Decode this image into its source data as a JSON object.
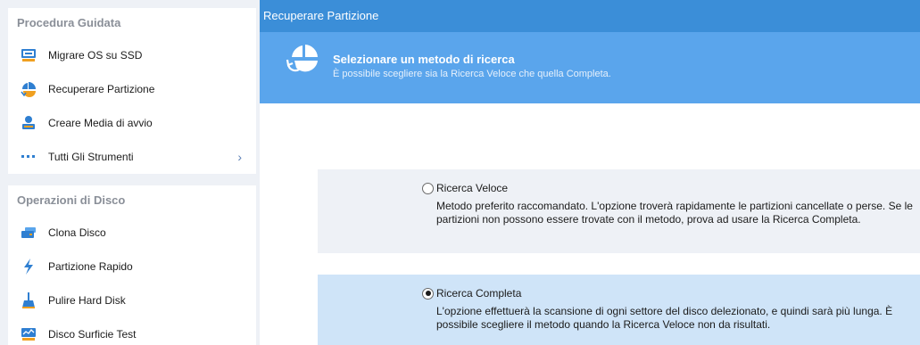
{
  "sidebar": {
    "section1": {
      "title": "Procedura Guidata",
      "items": [
        {
          "label": "Migrare OS su SSD",
          "icon": "migrate-os-icon"
        },
        {
          "label": "Recuperare Partizione",
          "icon": "partition-recovery-icon"
        },
        {
          "label": "Creare Media di avvio",
          "icon": "bootable-media-icon"
        },
        {
          "label": "Tutti Gli Strumenti",
          "icon": "more-dots-icon",
          "chevron": "›"
        }
      ]
    },
    "section2": {
      "title": "Operazioni di Disco",
      "items": [
        {
          "label": "Clona Disco",
          "icon": "clone-disk-icon"
        },
        {
          "label": "Partizione Rapido",
          "icon": "lightning-icon"
        },
        {
          "label": "Pulire Hard Disk",
          "icon": "broom-icon"
        },
        {
          "label": "Disco Surficie Test",
          "icon": "surface-test-icon"
        }
      ]
    }
  },
  "main": {
    "window_title": "Recuperare Partizione",
    "banner": {
      "title": "Selezionare un metodo di ricerca",
      "subtitle": "È possibile scegliere sia la Ricerca Veloce che quella Completa."
    },
    "options": [
      {
        "label": "Ricerca Veloce",
        "selected": false,
        "description": "Metodo preferito raccomandato. L'opzione troverà rapidamente le partizioni cancellate o perse. Se le partizioni non possono essere trovate con il metodo, prova ad usare la Ricerca Completa."
      },
      {
        "label": "Ricerca Completa",
        "selected": true,
        "description": "L'opzione effettuerà la scansione di ogni settore del disco delezionato, e quindi sarà più lunga. È possibile scegliere il metodo quando la Ricerca Veloce non da risultati."
      }
    ]
  },
  "colors": {
    "titlebar": "#3b8ed8",
    "banner": "#5aa5ec",
    "selected_option_bg": "#cfe4f8",
    "sidebar_bg": "#eef1f6",
    "icon_blue": "#2f7fd1"
  }
}
